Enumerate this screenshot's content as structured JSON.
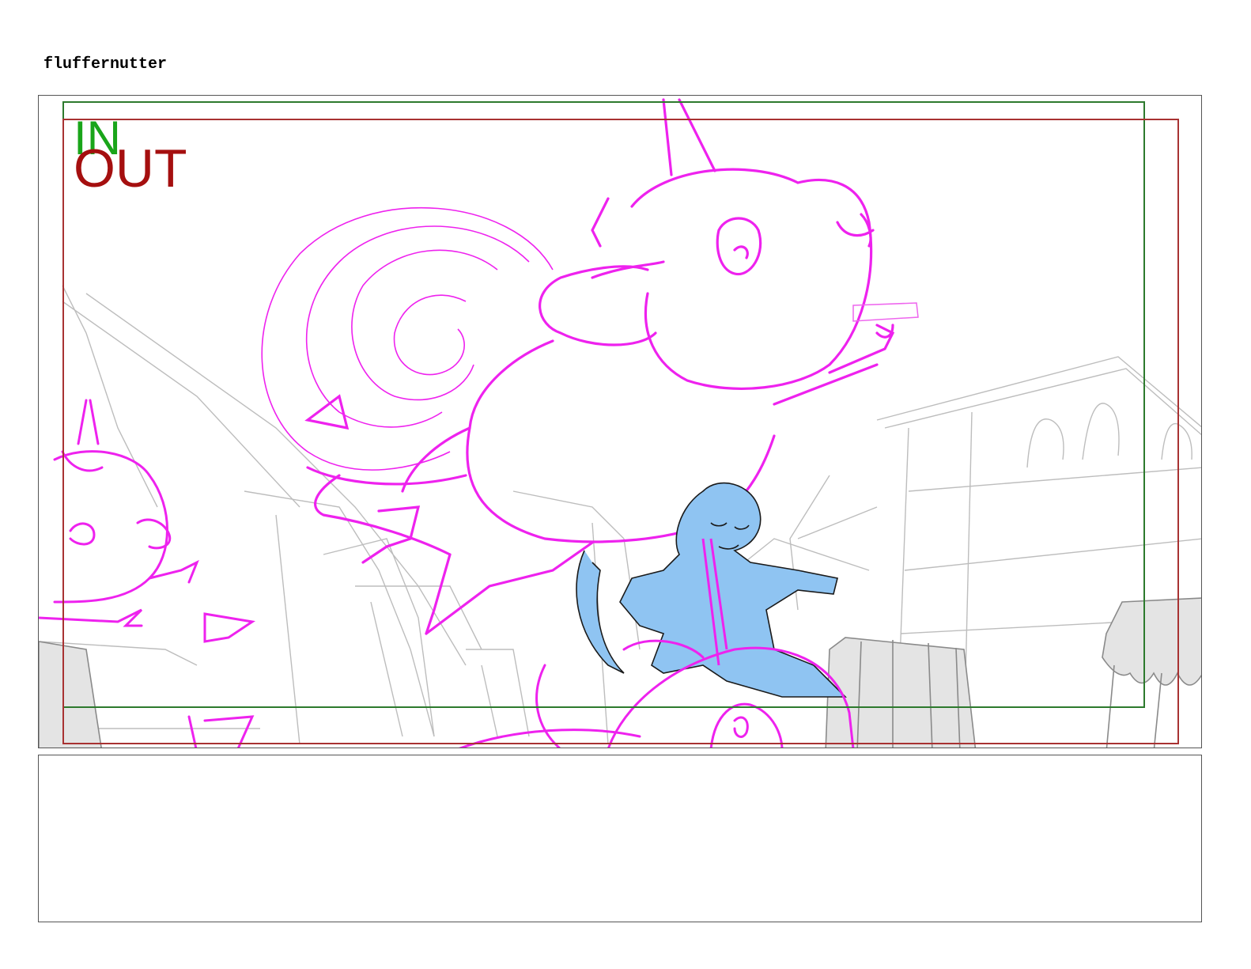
{
  "board": {
    "title": "fluffernutter",
    "in_label": "IN",
    "out_label": "OUT"
  },
  "colors": {
    "sketch_magenta": "#ee22ee",
    "character_fill": "#8fc4f2",
    "background_lines": "#b8b8b8",
    "in_frame": "#2d7a2d",
    "out_frame": "#a83232"
  }
}
